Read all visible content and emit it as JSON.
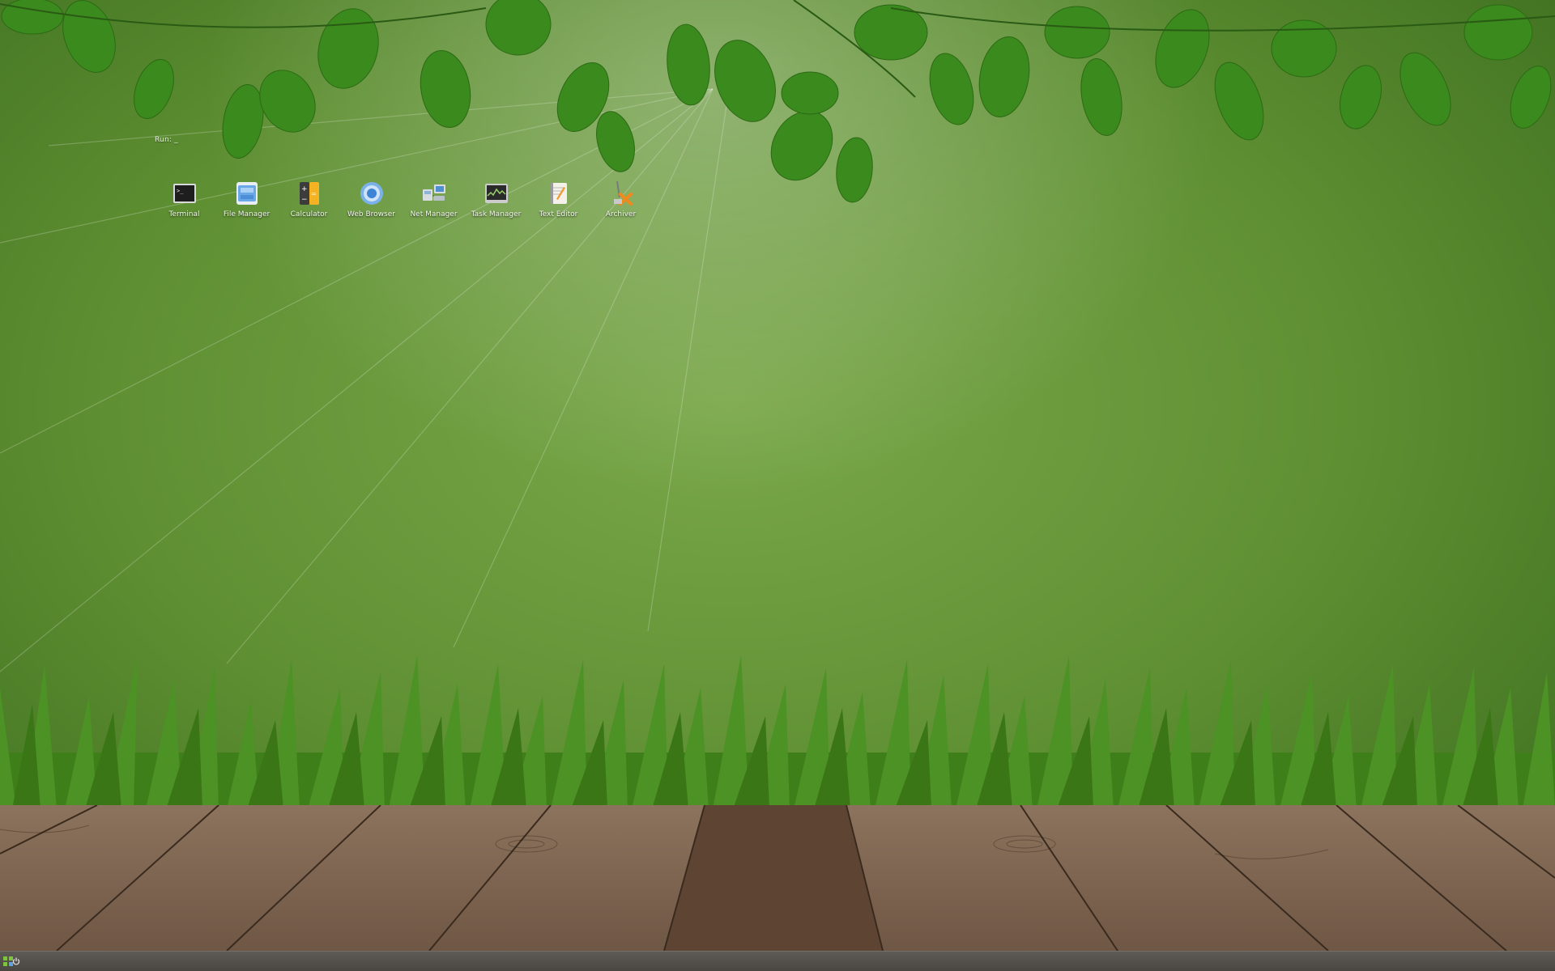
{
  "run_prompt": {
    "label": "Run:",
    "cursor": "_"
  },
  "desktop_icons": [
    {
      "label": "Terminal",
      "icon": "terminal-icon"
    },
    {
      "label": "File Manager",
      "icon": "file-manager-icon"
    },
    {
      "label": "Calculator",
      "icon": "calculator-icon"
    },
    {
      "label": "Web Browser",
      "icon": "web-browser-icon"
    },
    {
      "label": "Net Manager",
      "icon": "net-manager-icon"
    },
    {
      "label": "Task Manager",
      "icon": "task-manager-icon"
    },
    {
      "label": "Text Editor",
      "icon": "text-editor-icon"
    },
    {
      "label": "Archiver",
      "icon": "archiver-icon"
    }
  ],
  "taskbar": {
    "start_icon": "app-menu-icon",
    "power_icon": "power-icon"
  },
  "colors": {
    "wallpaper_green": "#6b9a3e",
    "leaf_green": "#3f8a1f",
    "grass_green": "#4f8f22",
    "wood_brown": "#7d6450",
    "taskbar": "#524e4a"
  }
}
